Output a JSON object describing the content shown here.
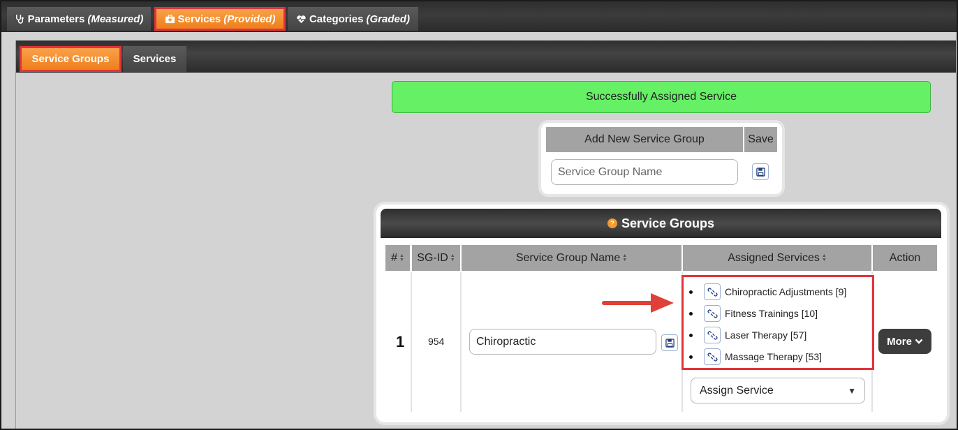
{
  "top_tabs": [
    {
      "label": "Parameters",
      "qualifier": "(Measured)"
    },
    {
      "label": "Services",
      "qualifier": "(Provided)"
    },
    {
      "label": "Categories",
      "qualifier": "(Graded)"
    }
  ],
  "sub_tabs": [
    {
      "label": "Service Groups"
    },
    {
      "label": "Services"
    }
  ],
  "success_message": "Successfully Assigned Service",
  "add_group": {
    "header_name": "Add New Service Group",
    "header_save": "Save",
    "placeholder": "Service Group Name"
  },
  "groups_panel": {
    "title": "Service Groups",
    "columns": [
      "#",
      "SG-ID",
      "Service Group Name",
      "Assigned Services",
      "Action"
    ],
    "rows": [
      {
        "num": "1",
        "sg_id": "954",
        "name": "Chiropractic",
        "assigned": [
          "Chiropractic Adjustments [9]",
          "Fitness Trainings [10]",
          "Laser Therapy [57]",
          "Massage Therapy [53]"
        ],
        "assign_select": "Assign Service",
        "action": "More"
      }
    ]
  },
  "colors": {
    "accent_orange": "#ef7f1a",
    "highlight_red": "#e0343a",
    "success_green": "#66f066"
  }
}
